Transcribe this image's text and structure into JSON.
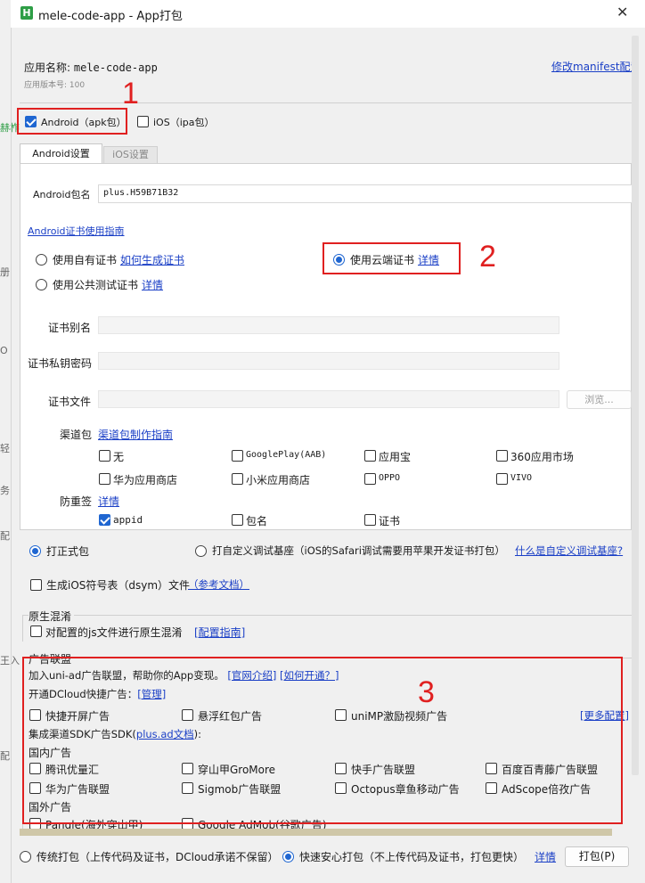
{
  "window": {
    "title": "mele-code-app - App打包",
    "app_icon_letter": "H",
    "app_icon_color": "#2e9e46",
    "accent": "#1f66d1",
    "annotation_color": "#e02020"
  },
  "background_strip": [
    "赫柞",
    "册",
    "O",
    "轻",
    "务",
    "配",
    "王入",
    "配"
  ],
  "header": {
    "app_name_label": "应用名称:",
    "app_name": "mele-code-app",
    "version_label": "应用版本号:",
    "version": "100",
    "manifest_link": "修改manifest配置"
  },
  "platforms": {
    "android": {
      "label": "Android（apk包）",
      "checked": true
    },
    "ios": {
      "label": "iOS（ipa包）",
      "checked": false
    }
  },
  "tabs": [
    {
      "label": "Android设置",
      "active": true
    },
    {
      "label": "iOS设置",
      "active": false
    }
  ],
  "android": {
    "package_label": "Android包名",
    "package_value": "plus.H59B71B32",
    "cert_guide_link": "Android证书使用指南",
    "cert_options": {
      "own": {
        "label": "使用自有证书",
        "link": "如何生成证书"
      },
      "public": {
        "label": "使用公共测试证书",
        "link": "详情"
      },
      "cloud": {
        "label": "使用云端证书",
        "link": "详情",
        "selected": true
      }
    },
    "cert_alias_label": "证书别名",
    "cert_password_label": "证书私钥密码",
    "cert_file_label": "证书文件",
    "browse_button": "浏览...",
    "channel_label": "渠道包",
    "channel_guide_link": "渠道包制作指南",
    "channels": [
      {
        "label": "无",
        "checked": false
      },
      {
        "label": "GooglePlay(AAB)",
        "checked": false
      },
      {
        "label": "应用宝",
        "checked": false
      },
      {
        "label": "360应用市场",
        "checked": false
      },
      {
        "label": "华为应用商店",
        "checked": false
      },
      {
        "label": "小米应用商店",
        "checked": false
      },
      {
        "label": "OPPO",
        "checked": false
      },
      {
        "label": "VIVO",
        "checked": false
      }
    ],
    "anti_resign_label": "防重签",
    "anti_resign_link": "详情",
    "anti_resign_options": [
      {
        "label": "appid",
        "checked": true
      },
      {
        "label": "包名",
        "checked": false
      },
      {
        "label": "证书",
        "checked": false
      }
    ]
  },
  "build_type": {
    "release": {
      "label": "打正式包",
      "selected": true
    },
    "custom_base": {
      "label": "打自定义调试基座（iOS的Safari调试需要用苹果开发证书打包）",
      "selected": false
    },
    "custom_base_link": "什么是自定义调试基座?"
  },
  "dsym": {
    "label": "生成iOS符号表（dsym）文件",
    "link": "（参考文档）",
    "checked": false
  },
  "obfuscation": {
    "title": "原生混淆",
    "option_label": "对配置的js文件进行原生混淆",
    "link": "[配置指南]",
    "checked": false
  },
  "ads": {
    "title": "广告联盟",
    "intro": "加入uni-ad广告联盟，帮助你的App变现。",
    "intro_link1": "[官网介绍]",
    "intro_link2": "[如何开通？]",
    "dcloud_label": "开通DCloud快捷广告：",
    "dcloud_link": "[管理]",
    "quick_ads": [
      {
        "label": "快捷开屏广告",
        "checked": false
      },
      {
        "label": "悬浮红包广告",
        "checked": false
      },
      {
        "label": "uniMP激励视频广告",
        "checked": false
      }
    ],
    "more_link": "[更多配置]",
    "sdk_label_prefix": "集成渠道SDK广告SDK(",
    "sdk_link": "plus.ad文档",
    "sdk_label_suffix": "):",
    "domestic_label": "国内广告",
    "domestic": [
      {
        "label": "腾讯优量汇",
        "checked": false
      },
      {
        "label": "穿山甲GroMore",
        "checked": false
      },
      {
        "label": "快手广告联盟",
        "checked": false
      },
      {
        "label": "百度百青藤广告联盟",
        "checked": false
      },
      {
        "label": "华为广告联盟",
        "checked": false
      },
      {
        "label": "Sigmob广告联盟",
        "checked": false
      },
      {
        "label": "Octopus章鱼移动广告",
        "checked": false
      },
      {
        "label": "AdScope倍孜广告",
        "checked": false
      }
    ],
    "overseas_label": "国外广告",
    "overseas": [
      {
        "label": "Pangle(海外穿山甲)",
        "checked": false
      },
      {
        "label": "Google AdMob(谷歌广告)",
        "checked": false
      }
    ]
  },
  "footer": {
    "traditional": {
      "label": "传统打包（上传代码及证书，DCloud承诺不保留）",
      "selected": false
    },
    "safe": {
      "label": "快速安心打包（不上传代码及证书，打包更快）",
      "selected": true
    },
    "detail_link": "详情",
    "build_button": "打包(P)"
  },
  "annotations": [
    "1",
    "2",
    "3"
  ]
}
